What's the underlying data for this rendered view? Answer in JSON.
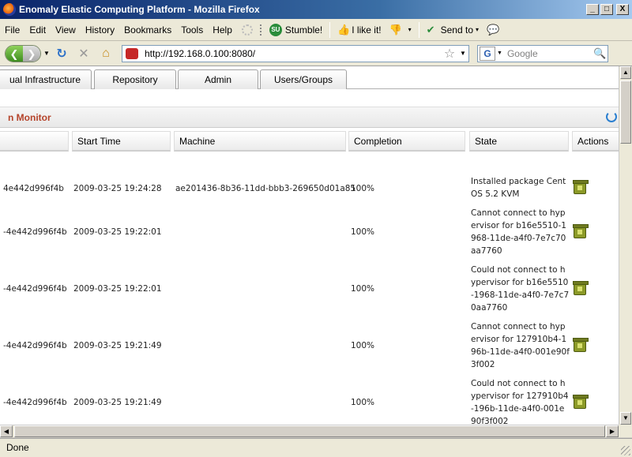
{
  "window": {
    "title": "Enomaly Elastic Computing Platform - Mozilla Firefox",
    "controls": [
      "_",
      "□",
      "X"
    ]
  },
  "menubar": {
    "items": [
      "File",
      "Edit",
      "View",
      "History",
      "Bookmarks",
      "Tools",
      "Help"
    ],
    "stumble_label": "Stumble!",
    "like_label": "I like it!",
    "sendto_label": "Send to"
  },
  "navbar": {
    "url": "http://192.168.0.100:8080/",
    "search_placeholder": "Google"
  },
  "tabs": [
    {
      "label": "ual Infrastructure"
    },
    {
      "label": "Repository"
    },
    {
      "label": "Admin"
    },
    {
      "label": "Users/Groups"
    }
  ],
  "panel": {
    "title": "n Monitor"
  },
  "table": {
    "columns": [
      "Start Time",
      "Machine",
      "Completion",
      "State",
      "Actions"
    ],
    "rows": [
      {
        "id": "4e442d996f4b",
        "start": "2009-03-25 19:24:28",
        "machine": "ae201436-8b36-11dd-bbb3-269650d01a85",
        "completion": "100%",
        "state": "Installed package CentOS 5.2 KVM"
      },
      {
        "id": "-4e442d996f4b",
        "start": "2009-03-25 19:22:01",
        "machine": "",
        "completion": "100%",
        "state": "Cannot connect to hypervisor for b16e5510-1968-11de-a4f0-7e7c70aa7760"
      },
      {
        "id": "-4e442d996f4b",
        "start": "2009-03-25 19:22:01",
        "machine": "",
        "completion": "100%",
        "state": "Could not connect to hypervisor for b16e5510-1968-11de-a4f0-7e7c70aa7760"
      },
      {
        "id": "-4e442d996f4b",
        "start": "2009-03-25 19:21:49",
        "machine": "",
        "completion": "100%",
        "state": "Cannot connect to hypervisor for 127910b4-196b-11de-a4f0-001e90f3f002"
      },
      {
        "id": "-4e442d996f4b",
        "start": "2009-03-25 19:21:49",
        "machine": "",
        "completion": "100%",
        "state": "Could not connect to hypervisor for 127910b4-196b-11de-a4f0-001e90f3f002"
      }
    ]
  },
  "status": {
    "text": "Done"
  }
}
